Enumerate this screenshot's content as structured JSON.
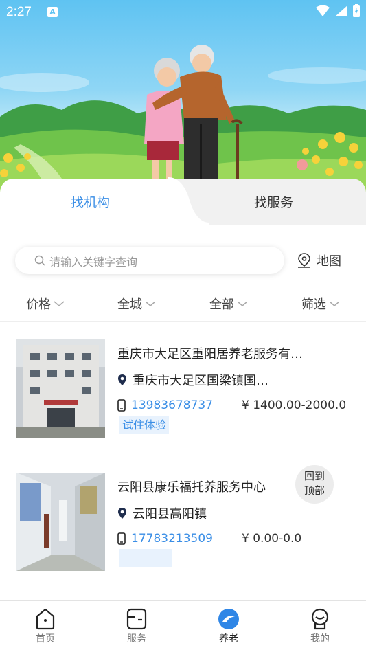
{
  "status_bar": {
    "time": "2:27",
    "badge": "A"
  },
  "tabs": [
    {
      "label": "找机构",
      "active": true
    },
    {
      "label": "找服务",
      "active": false
    }
  ],
  "search": {
    "placeholder": "请输入关键字查询",
    "icon": "search-icon"
  },
  "map_button": {
    "label": "地图",
    "icon": "map-pin-icon"
  },
  "filters": [
    "价格",
    "全城",
    "全部",
    "筛选"
  ],
  "listings": [
    {
      "name": "重庆市大足区重阳居养老服务有…",
      "address": "重庆市大足区国梁镇国…",
      "phone": "13983678737",
      "price": "¥ 1400.00-2000.0",
      "tag": "试住体验"
    },
    {
      "name": "云阳县康乐福托养服务中心",
      "address": "云阳县高阳镇",
      "phone": "17783213509",
      "price": "¥ 0.00-0.0",
      "tag": ""
    }
  ],
  "back_to_top": {
    "line1": "回到",
    "line2": "顶部"
  },
  "bottom_nav": [
    {
      "label": "首页",
      "icon": "home-icon",
      "active": false
    },
    {
      "label": "服务",
      "icon": "service-icon",
      "active": false
    },
    {
      "label": "养老",
      "icon": "elderly-care-icon",
      "active": true
    },
    {
      "label": "我的",
      "icon": "profile-icon",
      "active": false
    }
  ],
  "colors": {
    "accent": "#3a8ee6",
    "sky": "#5fc3f2",
    "tag_bg": "#e8f2fd"
  }
}
